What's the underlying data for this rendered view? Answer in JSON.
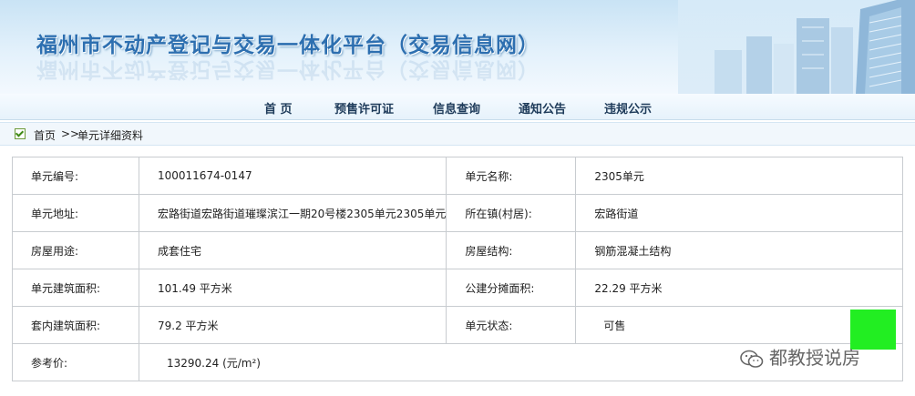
{
  "header": {
    "title": "福州市不动产登记与交易一体化平台（交易信息网）"
  },
  "nav": {
    "items": [
      "首 页",
      "预售许可证",
      "信息查询",
      "通知公告",
      "违规公示"
    ]
  },
  "breadcrumb": {
    "home": "首页",
    "separator": ">>",
    "current": "单元详细资料"
  },
  "details": {
    "row1": {
      "k1": "单元编号:",
      "v1": "100011674-0147",
      "k2": "单元名称:",
      "v2": "2305单元"
    },
    "row2": {
      "k1": "单元地址:",
      "v1": "宏路街道宏路街道璀璨滨江一期20号楼2305单元2305单元",
      "k2": "所在镇(村居):",
      "v2": "宏路街道"
    },
    "row3": {
      "k1": "房屋用途:",
      "v1": "成套住宅",
      "k2": "房屋结构:",
      "v2": "钢筋混凝土结构"
    },
    "row4": {
      "k1": "单元建筑面积:",
      "v1": "101.49 平方米",
      "k2": "公建分摊面积:",
      "v2": "22.29 平方米"
    },
    "row5": {
      "k1": "套内建筑面积:",
      "v1": "79.2 平方米",
      "k2": "单元状态:",
      "v2": "可售"
    },
    "row6": {
      "k1": "参考价:",
      "v1": "13290.24 (元/m²)"
    }
  },
  "watermark": {
    "text": "都教授说房"
  },
  "colors": {
    "title": "#2d6fb0",
    "status_green": "#22ee22",
    "border": "#c8ccd0"
  }
}
